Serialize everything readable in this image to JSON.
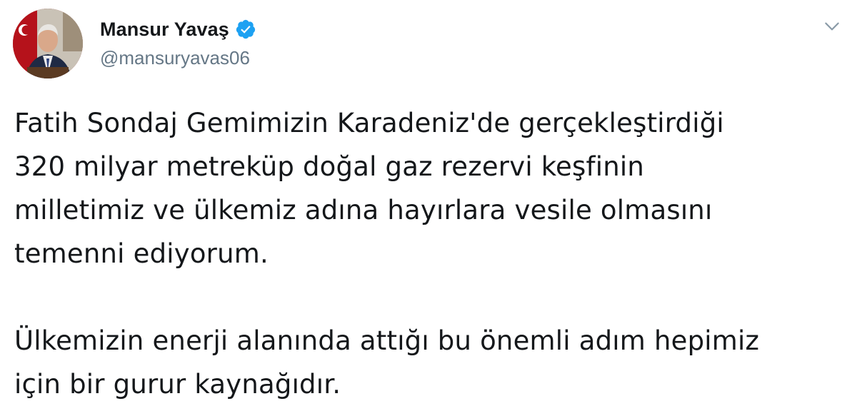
{
  "author": {
    "display_name": "Mansur Yavaş",
    "handle": "@mansuryavas06",
    "verified": true,
    "avatar_icon": "profile-photo",
    "verified_icon": "verified-badge-icon",
    "verified_color": "#1da1f2"
  },
  "menu": {
    "icon": "chevron-down-icon",
    "color": "#8899a6"
  },
  "tweet": {
    "paragraph1_lines": [
      "Fatih Sondaj Gemimizin Karadeniz'de gerçekleştirdiği",
      "320 milyar metreküp doğal gaz rezervi keşfinin",
      "milletimiz ve ülkemiz adına hayırlara vesile olmasını",
      "temenni ediyorum."
    ],
    "paragraph2_lines": [
      "Ülkemizin enerji alanında attığı bu önemli adım hepimiz",
      "için bir gurur kaynağıdır."
    ]
  }
}
